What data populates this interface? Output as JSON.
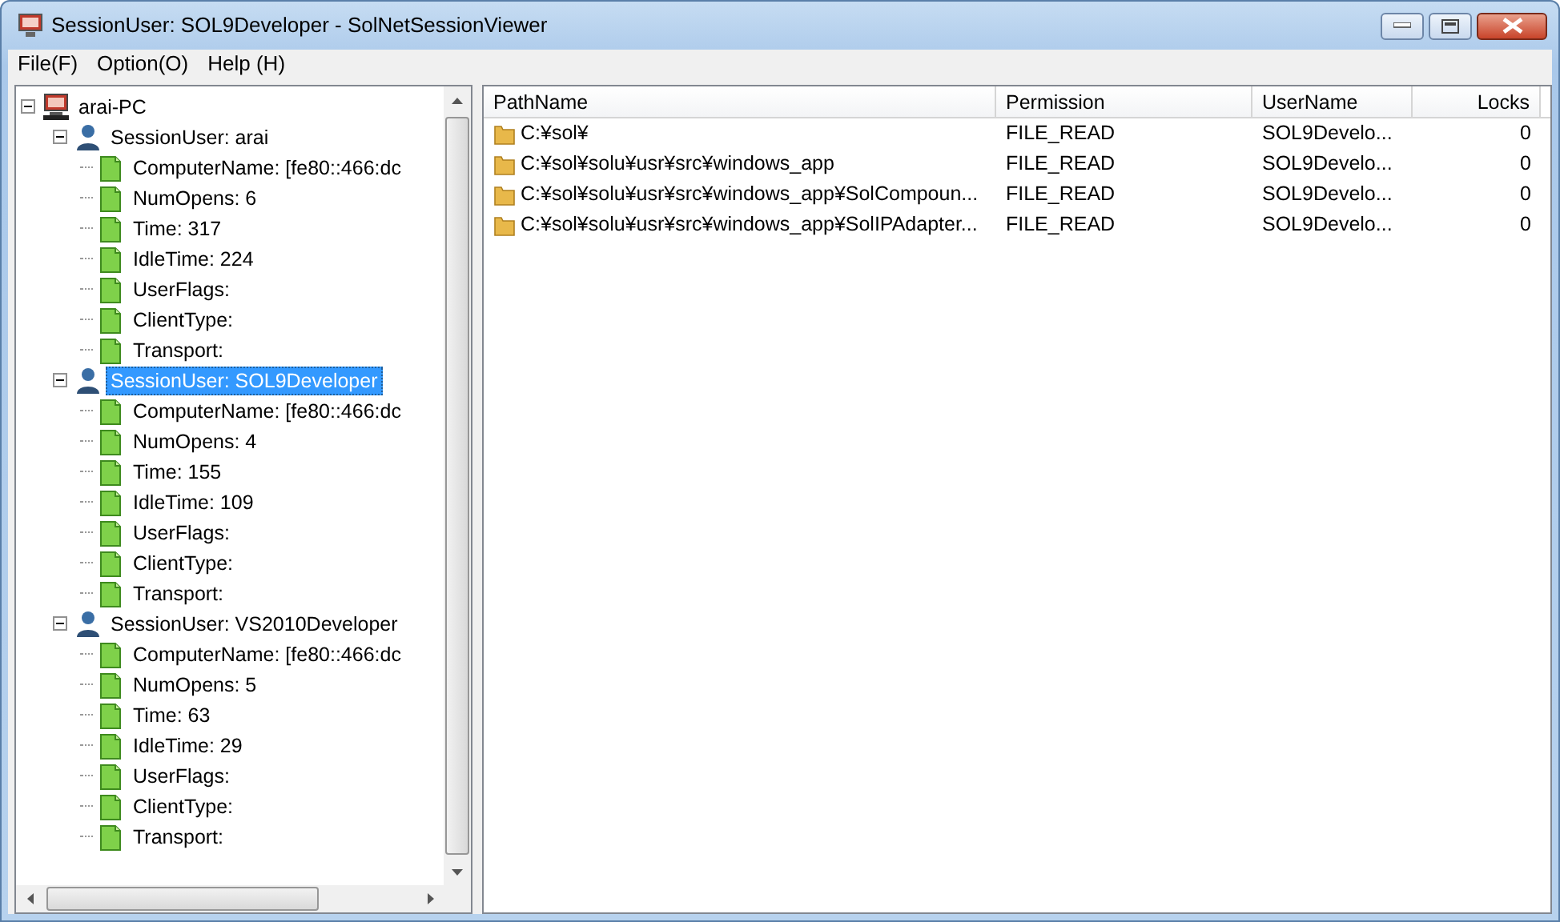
{
  "window": {
    "title": "SessionUser: SOL9Developer - SolNetSessionViewer"
  },
  "menu": [
    "File(F)",
    "Option(O)",
    "Help (H)"
  ],
  "tree": {
    "label": "arai-PC",
    "kind": "computer",
    "expanded": true,
    "selected": false,
    "children": [
      {
        "label": "SessionUser: arai",
        "kind": "user",
        "expanded": true,
        "selected": false,
        "children": [
          {
            "label": "ComputerName: [fe80::466:dc",
            "kind": "property",
            "selected": false
          },
          {
            "label": "NumOpens: 6",
            "kind": "property",
            "selected": false
          },
          {
            "label": "Time: 317",
            "kind": "property",
            "selected": false
          },
          {
            "label": "IdleTime: 224",
            "kind": "property",
            "selected": false
          },
          {
            "label": "UserFlags:",
            "kind": "property",
            "selected": false
          },
          {
            "label": "ClientType:",
            "kind": "property",
            "selected": false
          },
          {
            "label": "Transport:",
            "kind": "property",
            "selected": false
          }
        ]
      },
      {
        "label": "SessionUser: SOL9Developer",
        "kind": "user",
        "expanded": true,
        "selected": true,
        "children": [
          {
            "label": "ComputerName: [fe80::466:dc",
            "kind": "property",
            "selected": false
          },
          {
            "label": "NumOpens: 4",
            "kind": "property",
            "selected": false
          },
          {
            "label": "Time: 155",
            "kind": "property",
            "selected": false
          },
          {
            "label": "IdleTime: 109",
            "kind": "property",
            "selected": false
          },
          {
            "label": "UserFlags:",
            "kind": "property",
            "selected": false
          },
          {
            "label": "ClientType:",
            "kind": "property",
            "selected": false
          },
          {
            "label": "Transport:",
            "kind": "property",
            "selected": false
          }
        ]
      },
      {
        "label": "SessionUser: VS2010Developer",
        "kind": "user",
        "expanded": true,
        "selected": false,
        "children": [
          {
            "label": "ComputerName: [fe80::466:dc",
            "kind": "property",
            "selected": false
          },
          {
            "label": "NumOpens: 5",
            "kind": "property",
            "selected": false
          },
          {
            "label": "Time: 63",
            "kind": "property",
            "selected": false
          },
          {
            "label": "IdleTime: 29",
            "kind": "property",
            "selected": false
          },
          {
            "label": "UserFlags:",
            "kind": "property",
            "selected": false
          },
          {
            "label": "ClientType:",
            "kind": "property",
            "selected": false
          },
          {
            "label": "Transport:",
            "kind": "property",
            "selected": false
          }
        ]
      }
    ]
  },
  "table": {
    "columns": [
      "PathName",
      "Permission",
      "UserName",
      "Locks"
    ],
    "rows": [
      {
        "path": "C:¥sol¥",
        "permission": "FILE_READ",
        "user": "SOL9Develo...",
        "locks": "0"
      },
      {
        "path": "C:¥sol¥solu¥usr¥src¥windows_app",
        "permission": "FILE_READ",
        "user": "SOL9Develo...",
        "locks": "0"
      },
      {
        "path": "C:¥sol¥solu¥usr¥src¥windows_app¥SolCompoun...",
        "permission": "FILE_READ",
        "user": "SOL9Develo...",
        "locks": "0"
      },
      {
        "path": "C:¥sol¥solu¥usr¥src¥windows_app¥SolIPAdapter...",
        "permission": "FILE_READ",
        "user": "SOL9Develo...",
        "locks": "0"
      }
    ]
  }
}
